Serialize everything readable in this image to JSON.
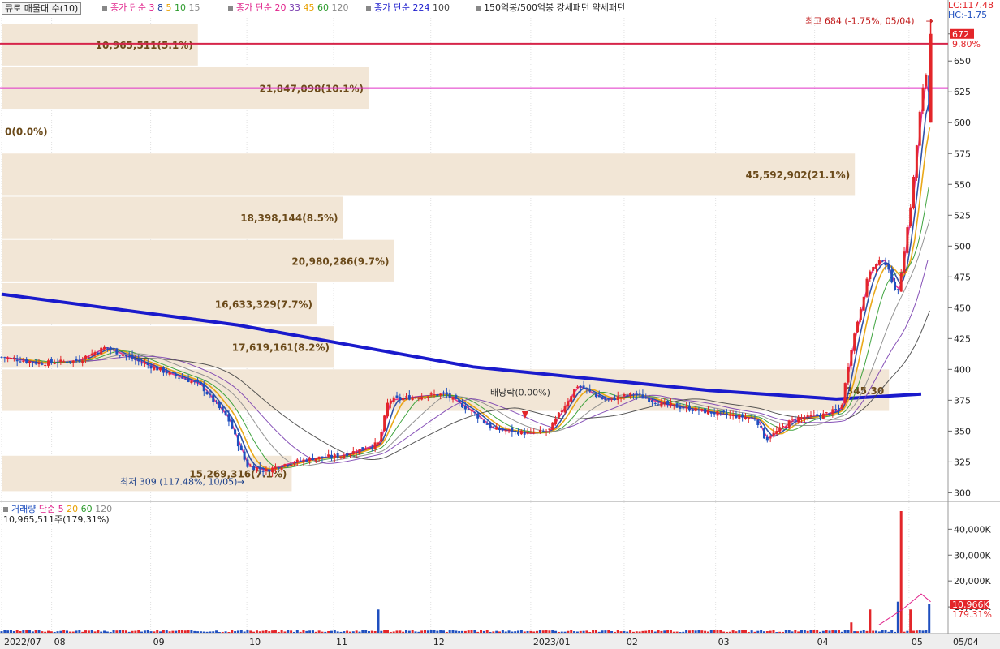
{
  "indicators": {
    "box_label": "큐로 매물대 수(10)",
    "ma_price": {
      "prefix": "종가 단순",
      "periods": [
        "3",
        "8",
        "5",
        "10",
        "15"
      ],
      "colors": [
        "#e0218a",
        "#1a3fa0",
        "#e8a000",
        "#2b9a2b",
        "#888888"
      ]
    },
    "ma_price2": {
      "prefix": "종가 단순",
      "periods": [
        "20",
        "33",
        "45",
        "60",
        "120"
      ],
      "colors": [
        "#e0218a",
        "#7a3fb0",
        "#e8a000",
        "#2b9a2b",
        "#888888"
      ]
    },
    "ma_long": {
      "prefix": "종가 단순",
      "periods": [
        "224",
        "100"
      ],
      "colors": [
        "#1a1acc",
        "#444444"
      ]
    },
    "pattern": "150억봉/500억봉 강세패턴  약세패턴"
  },
  "scale_info": {
    "lc": "LC:117.48",
    "hc": "HC:-1.75"
  },
  "volume_legend": {
    "label": "거래량",
    "prefix": "단순",
    "periods": [
      "5",
      "20",
      "60",
      "120"
    ],
    "colors": [
      "#e0218a",
      "#e8a000",
      "#2b9a2b",
      "#888888"
    ]
  },
  "volume_info": "10,965,511주(179,31%)",
  "annotations": {
    "high": "최고 684 (-1.75%, 05/04)",
    "low": "최저 309 (117.48%, 10/05)",
    "dividend": "배당락(0.00%)"
  },
  "price_tags": {
    "current": "672",
    "change": "9.80%"
  },
  "volume_tags": {
    "current": "10,966K",
    "ratio": "179.31%"
  },
  "colors": {
    "up": "#e3262a",
    "down": "#1f4fbf",
    "ma224": "#1a1acc",
    "resistance_red": "#d6254a",
    "resistance_magenta": "#e030c8",
    "profile": "#f2e6d6",
    "profile_text": "#6b4a1a"
  },
  "chart_data": {
    "type": "candlestick",
    "x_labels": [
      "2022/07",
      "08",
      "09",
      "10",
      "11",
      "12",
      "2023/01",
      "02",
      "03",
      "04",
      "05",
      "05/04"
    ],
    "y_ticks": [
      300,
      325,
      350,
      375,
      400,
      425,
      450,
      475,
      500,
      525,
      550,
      575,
      600,
      625,
      650,
      672
    ],
    "ylim": [
      295,
      685
    ],
    "horizontal_lines": [
      {
        "value": 664,
        "color": "red"
      },
      {
        "value": 628,
        "color": "magenta"
      }
    ],
    "volume_profile": [
      {
        "low": 645,
        "high": 680,
        "label": "10,965,511(5.1%)",
        "width_ratio": 0.23
      },
      {
        "low": 610,
        "high": 645,
        "label": "21,847,098(10.1%)",
        "width_ratio": 0.43
      },
      {
        "low": 575,
        "high": 610,
        "label": "0(0.0%)",
        "width_ratio": 0.0
      },
      {
        "low": 540,
        "high": 575,
        "label": "45,592,902(21.1%)",
        "width_ratio": 1.0
      },
      {
        "low": 505,
        "high": 540,
        "label": "18,398,144(8.5%)",
        "width_ratio": 0.4
      },
      {
        "low": 470,
        "high": 505,
        "label": "20,980,286(9.7%)",
        "width_ratio": 0.46
      },
      {
        "low": 435,
        "high": 470,
        "label": "16,633,329(7.7%)",
        "width_ratio": 0.37
      },
      {
        "low": 400,
        "high": 435,
        "label": "17,619,161(8.2%)",
        "width_ratio": 0.39
      },
      {
        "low": 365,
        "high": 400,
        "label": "345.30",
        "width_ratio": 1.04
      },
      {
        "low": 300,
        "high": 330,
        "label": "15,269,316(7.1%)",
        "width_ratio": 0.34
      }
    ],
    "ma224": [
      [
        0,
        461
      ],
      [
        0.25,
        436
      ],
      [
        0.5,
        402
      ],
      [
        0.75,
        383
      ],
      [
        0.885,
        376
      ],
      [
        0.975,
        380
      ]
    ],
    "price_path": [
      [
        0,
        410
      ],
      [
        0.04,
        405
      ],
      [
        0.08,
        407
      ],
      [
        0.11,
        418
      ],
      [
        0.14,
        408
      ],
      [
        0.18,
        396
      ],
      [
        0.21,
        388
      ],
      [
        0.24,
        360
      ],
      [
        0.26,
        322
      ],
      [
        0.28,
        318
      ],
      [
        0.3,
        323
      ],
      [
        0.33,
        328
      ],
      [
        0.36,
        330
      ],
      [
        0.4,
        340
      ],
      [
        0.41,
        375
      ],
      [
        0.44,
        378
      ],
      [
        0.47,
        380
      ],
      [
        0.5,
        365
      ],
      [
        0.52,
        352
      ],
      [
        0.56,
        348
      ],
      [
        0.58,
        350
      ],
      [
        0.61,
        387
      ],
      [
        0.64,
        375
      ],
      [
        0.67,
        380
      ],
      [
        0.7,
        372
      ],
      [
        0.73,
        368
      ],
      [
        0.76,
        364
      ],
      [
        0.8,
        360
      ],
      [
        0.81,
        343
      ],
      [
        0.84,
        360
      ],
      [
        0.87,
        363
      ],
      [
        0.89,
        368
      ],
      [
        0.9,
        415
      ],
      [
        0.92,
        480
      ],
      [
        0.935,
        490
      ],
      [
        0.95,
        460
      ],
      [
        0.965,
        540
      ],
      [
        0.975,
        620
      ],
      [
        0.98,
        640
      ],
      [
        0.985,
        595
      ]
    ],
    "volume_axis": [
      10000,
      20000,
      30000,
      40000
    ],
    "volume_ylim": [
      0,
      47000
    ],
    "volume_spikes": [
      {
        "x": 0.4,
        "v": 9000
      },
      {
        "x": 0.9,
        "v": 4000
      },
      {
        "x": 0.92,
        "v": 9000
      },
      {
        "x": 0.95,
        "v": 12000
      },
      {
        "x": 0.955,
        "v": 47000
      },
      {
        "x": 0.965,
        "v": 9000
      },
      {
        "x": 0.985,
        "v": 10966
      }
    ]
  }
}
